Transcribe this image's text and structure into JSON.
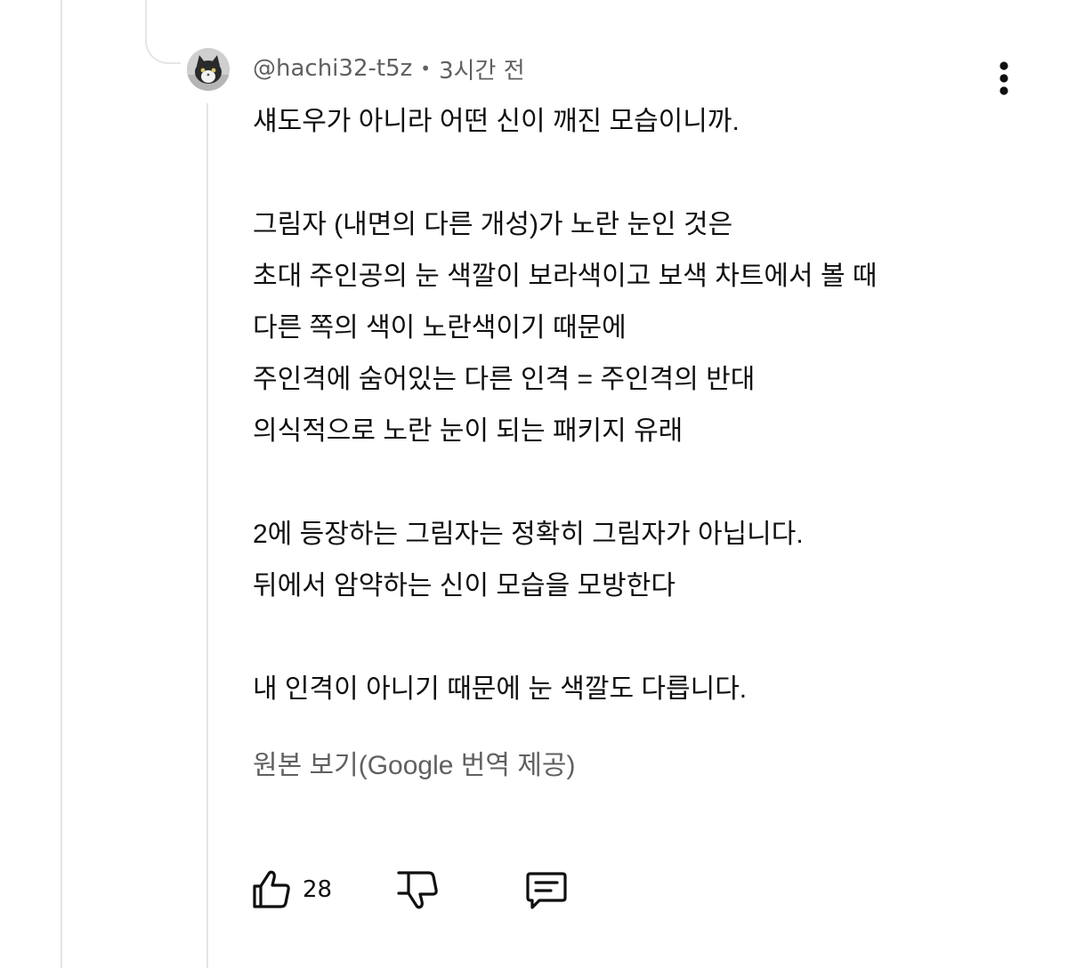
{
  "comment": {
    "handle": "@hachi32-t5z",
    "separator": "•",
    "time": "3시간 전",
    "lines": [
      "섀도우가 아니라 어떤 신이 깨진 모습이니까.",
      "",
      "그림자 (내면의 다른 개성)가 노란 눈인 것은",
      "초대 주인공의 눈 색깔이 보라색이고 보색 차트에서 볼 때",
      "다른 쪽의 색이 노란색이기 때문에",
      "주인격에 숨어있는 다른 인격 = 주인격의 반대",
      "의식적으로 노란 눈이 되는 패키지 유래",
      "",
      "2에 등장하는 그림자는 정확히 그림자가 아닙니다.",
      "뒤에서 암약하는 신이 모습을 모방한다",
      "",
      "내 인격이 아니기 때문에 눈 색깔도 다릅니다."
    ],
    "see_original": "원본 보기(Google 번역 제공)",
    "like_count": "28"
  },
  "icons": {
    "avatar": "avatar-cat-image",
    "more": "kebab-menu-icon",
    "like": "thumbs-up-icon",
    "dislike": "thumbs-down-icon",
    "reply": "reply-comment-icon"
  },
  "colors": {
    "text": "#0f0f0f",
    "secondary_text": "#606060",
    "thread_line": "#e5e5e5",
    "background": "#ffffff"
  }
}
